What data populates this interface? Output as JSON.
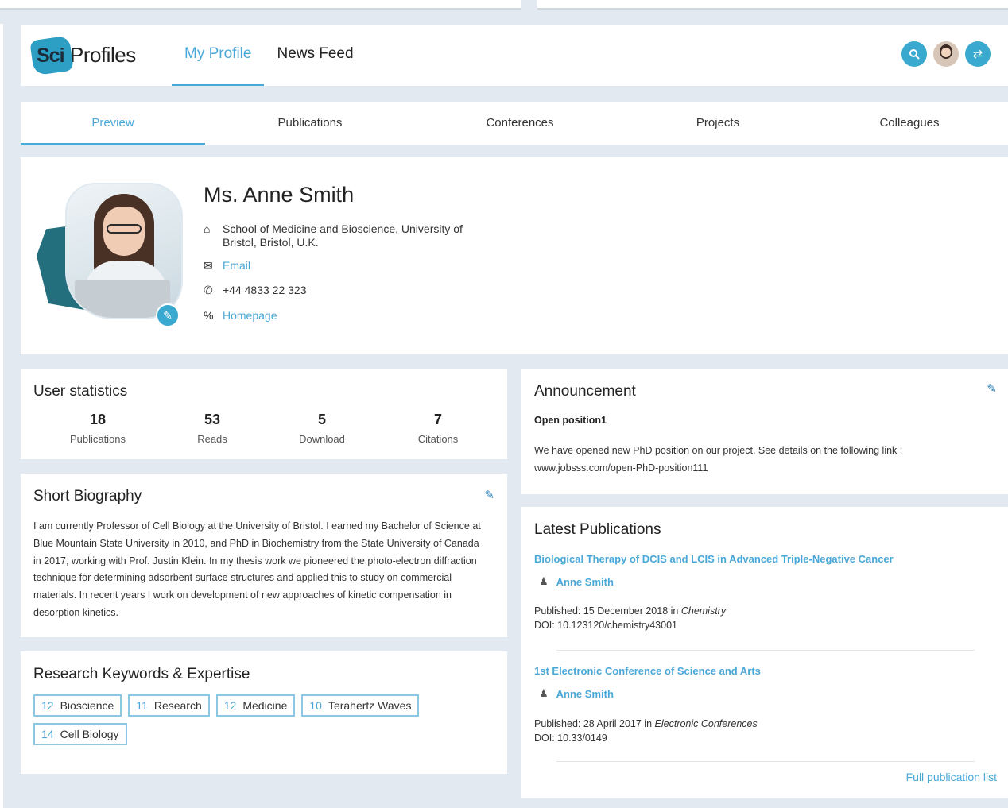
{
  "app": {
    "logo_badge": "Sci",
    "logo_text": "Profiles"
  },
  "header": {
    "nav": [
      {
        "label": "My Profile",
        "active": true
      },
      {
        "label": "News Feed",
        "active": false
      }
    ],
    "icons": [
      "search-icon",
      "user-avatar",
      "switch-icon"
    ]
  },
  "tabs": [
    {
      "label": "Preview",
      "active": true
    },
    {
      "label": "Publications",
      "active": false
    },
    {
      "label": "Conferences",
      "active": false
    },
    {
      "label": "Projects",
      "active": false
    },
    {
      "label": "Colleagues",
      "active": false
    }
  ],
  "profile": {
    "name": "Ms. Anne Smith",
    "affiliation": "School of Medicine and Bioscience, University of Bristol, Bristol, U.K.",
    "email_label": "Email",
    "phone": "+44 4833 22 323",
    "homepage_label": "Homepage"
  },
  "stats": {
    "title": "User statistics",
    "items": [
      {
        "value": "18",
        "label": "Publications"
      },
      {
        "value": "53",
        "label": "Reads"
      },
      {
        "value": "5",
        "label": "Download"
      },
      {
        "value": "7",
        "label": "Citations"
      }
    ]
  },
  "bio": {
    "title": "Short Biography",
    "text": "I am currently Professor of Cell Biology at the University of Bristol. I earned my Bachelor of Science at Blue Mountain State University in 2010, and PhD in Biochemistry from the State University of Canada in 2017, working with Prof. Justin Klein. In my thesis work we pioneered the photo-electron diffraction technique for determining adsorbent surface structures and applied this to study on commercial materials. In recent years I work on development of new approaches of kinetic compensation in desorption kinetics."
  },
  "keywords": {
    "title": "Research Keywords & Expertise",
    "items": [
      {
        "count": "12",
        "label": "Bioscience"
      },
      {
        "count": "11",
        "label": "Research"
      },
      {
        "count": "12",
        "label": "Medicine"
      },
      {
        "count": "10",
        "label": "Terahertz Waves"
      },
      {
        "count": "14",
        "label": "Cell Biology"
      }
    ]
  },
  "announcement": {
    "title": "Announcement",
    "subtitle": "Open position1",
    "text": "We have opened new PhD position on our project. See details on the following link : www.jobsss.com/open-PhD-position111"
  },
  "latest": {
    "title": "Latest Publications",
    "items": [
      {
        "title": "Biological Therapy of DCIS and LCIS in Advanced Triple-Negative Cancer",
        "author": "Anne Smith",
        "published_prefix": "Published: 15 December 2018 in ",
        "venue": "Chemistry",
        "doi": "DOI: 10.123120/chemistry43001"
      },
      {
        "title": "1st Electronic Conference of Science and Arts",
        "author": "Anne Smith",
        "published_prefix": "Published: 28 April 2017 in ",
        "venue": "Electronic Conferences",
        "doi": "DOI: 10.33/0149"
      }
    ],
    "full_list_label": "Full publication list"
  },
  "colors": {
    "accent": "#4aa8d8",
    "teal": "#3aa9cf",
    "photo_shape": "#246f7d",
    "background": "#e3e9f0"
  }
}
